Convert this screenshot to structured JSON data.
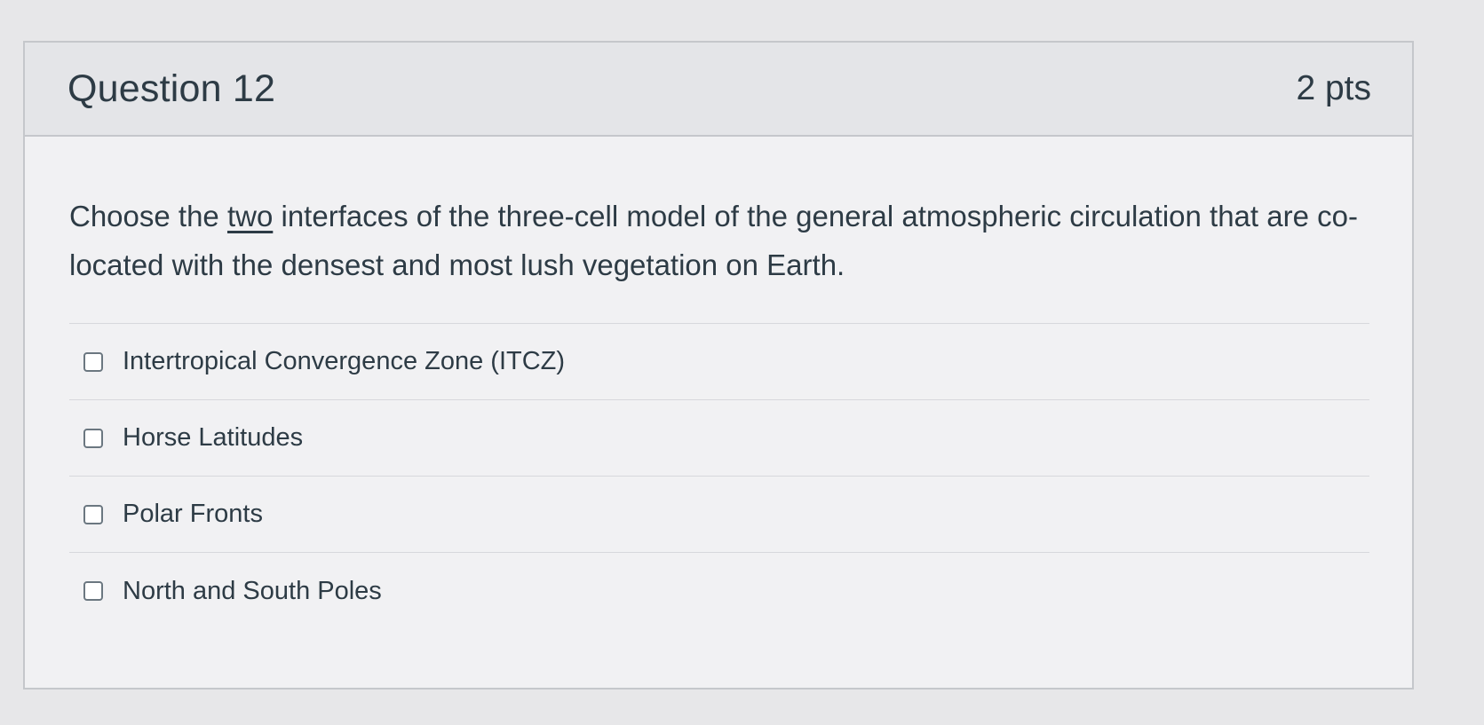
{
  "question": {
    "title": "Question 12",
    "points": "2 pts",
    "text_before": "Choose the ",
    "text_emphasis": "two",
    "text_after": " interfaces of the three-cell model of the general atmospheric circulation that are co-located with the densest and most lush vegetation on Earth."
  },
  "answers": [
    {
      "label": "Intertropical Convergence Zone (ITCZ)",
      "checked": false
    },
    {
      "label": "Horse Latitudes",
      "checked": false
    },
    {
      "label": "Polar Fronts",
      "checked": false
    },
    {
      "label": "North and South Poles",
      "checked": false
    }
  ],
  "colors": {
    "text": "#2d3b45",
    "header_bg": "#e4e5e8",
    "card_bg": "#f1f1f3",
    "border": "#c5c7cb"
  }
}
